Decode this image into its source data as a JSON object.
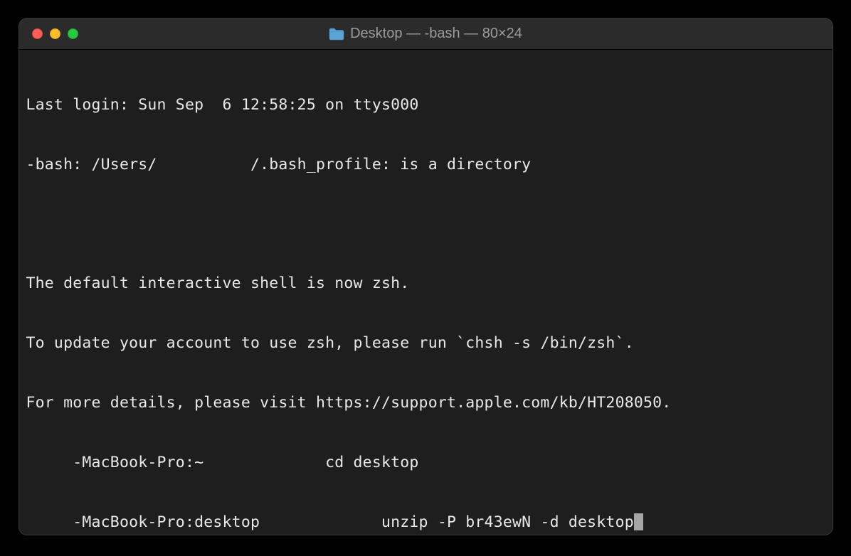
{
  "titlebar": {
    "title": "Desktop — -bash — 80×24"
  },
  "terminal": {
    "lines": [
      "Last login: Sun Sep  6 12:58:25 on ttys000",
      "-bash: /Users/          /.bash_profile: is a directory",
      "",
      "The default interactive shell is now zsh.",
      "To update your account to use zsh, please run `chsh -s /bin/zsh`.",
      "For more details, please visit https://support.apple.com/kb/HT208050.",
      "     -MacBook-Pro:~             cd desktop",
      "     -MacBook-Pro:desktop             unzip -P br43ewN -d desktop"
    ]
  }
}
